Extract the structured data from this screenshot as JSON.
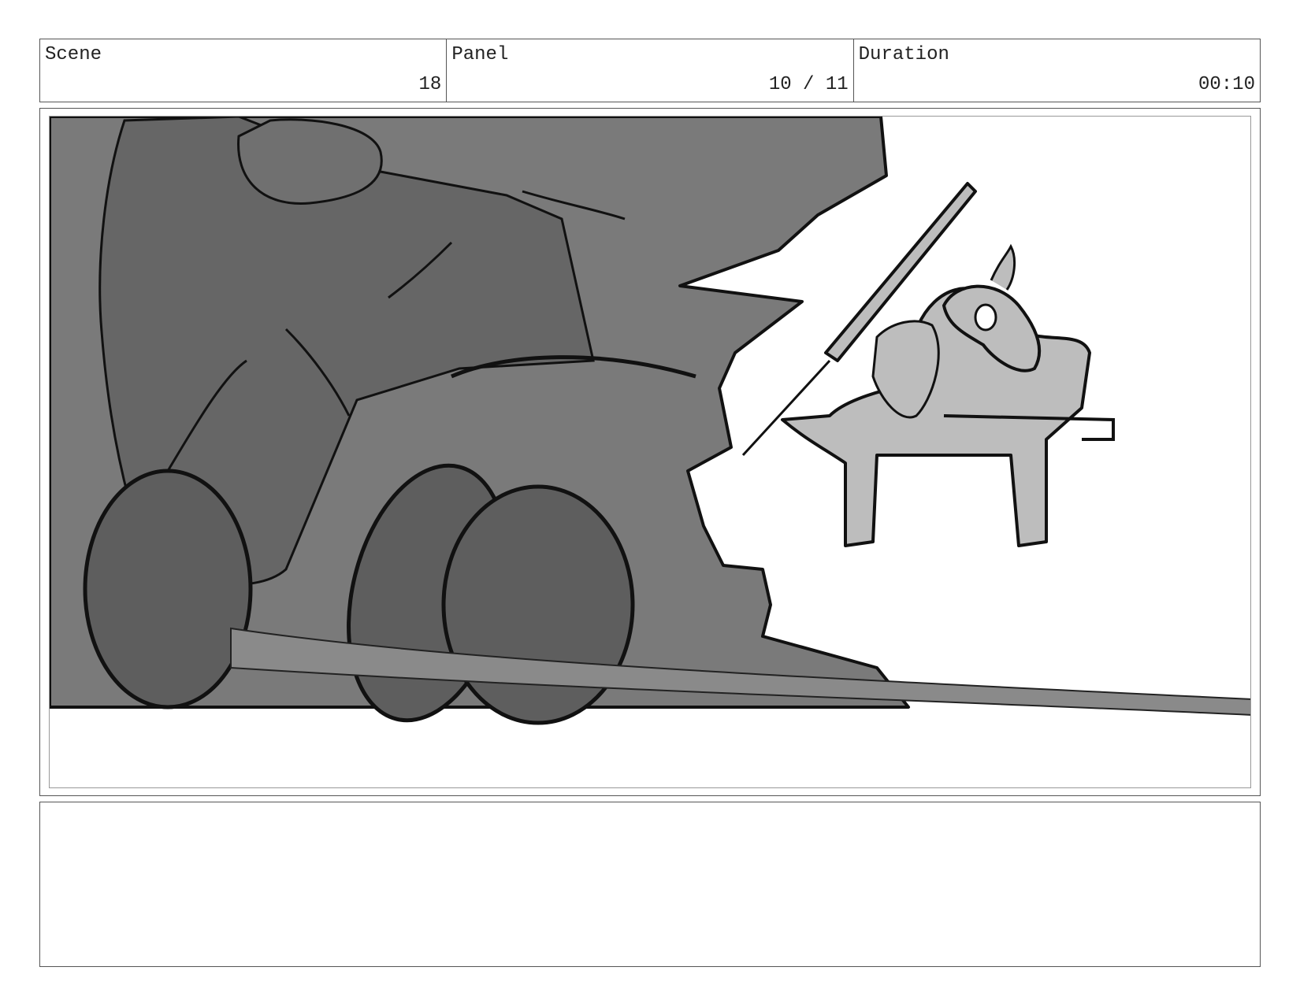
{
  "header": {
    "scene_label": "Scene",
    "scene_value": "18",
    "panel_label": "Panel",
    "panel_value": "10 / 11",
    "duration_label": "Duration",
    "duration_value": "00:10"
  },
  "notes": {
    "text": ""
  },
  "colors": {
    "dark_fill": "#6e6e6e",
    "wheel_fill": "#5e5e5e",
    "light_fill": "#bdbdbd",
    "ink": "#111111"
  }
}
